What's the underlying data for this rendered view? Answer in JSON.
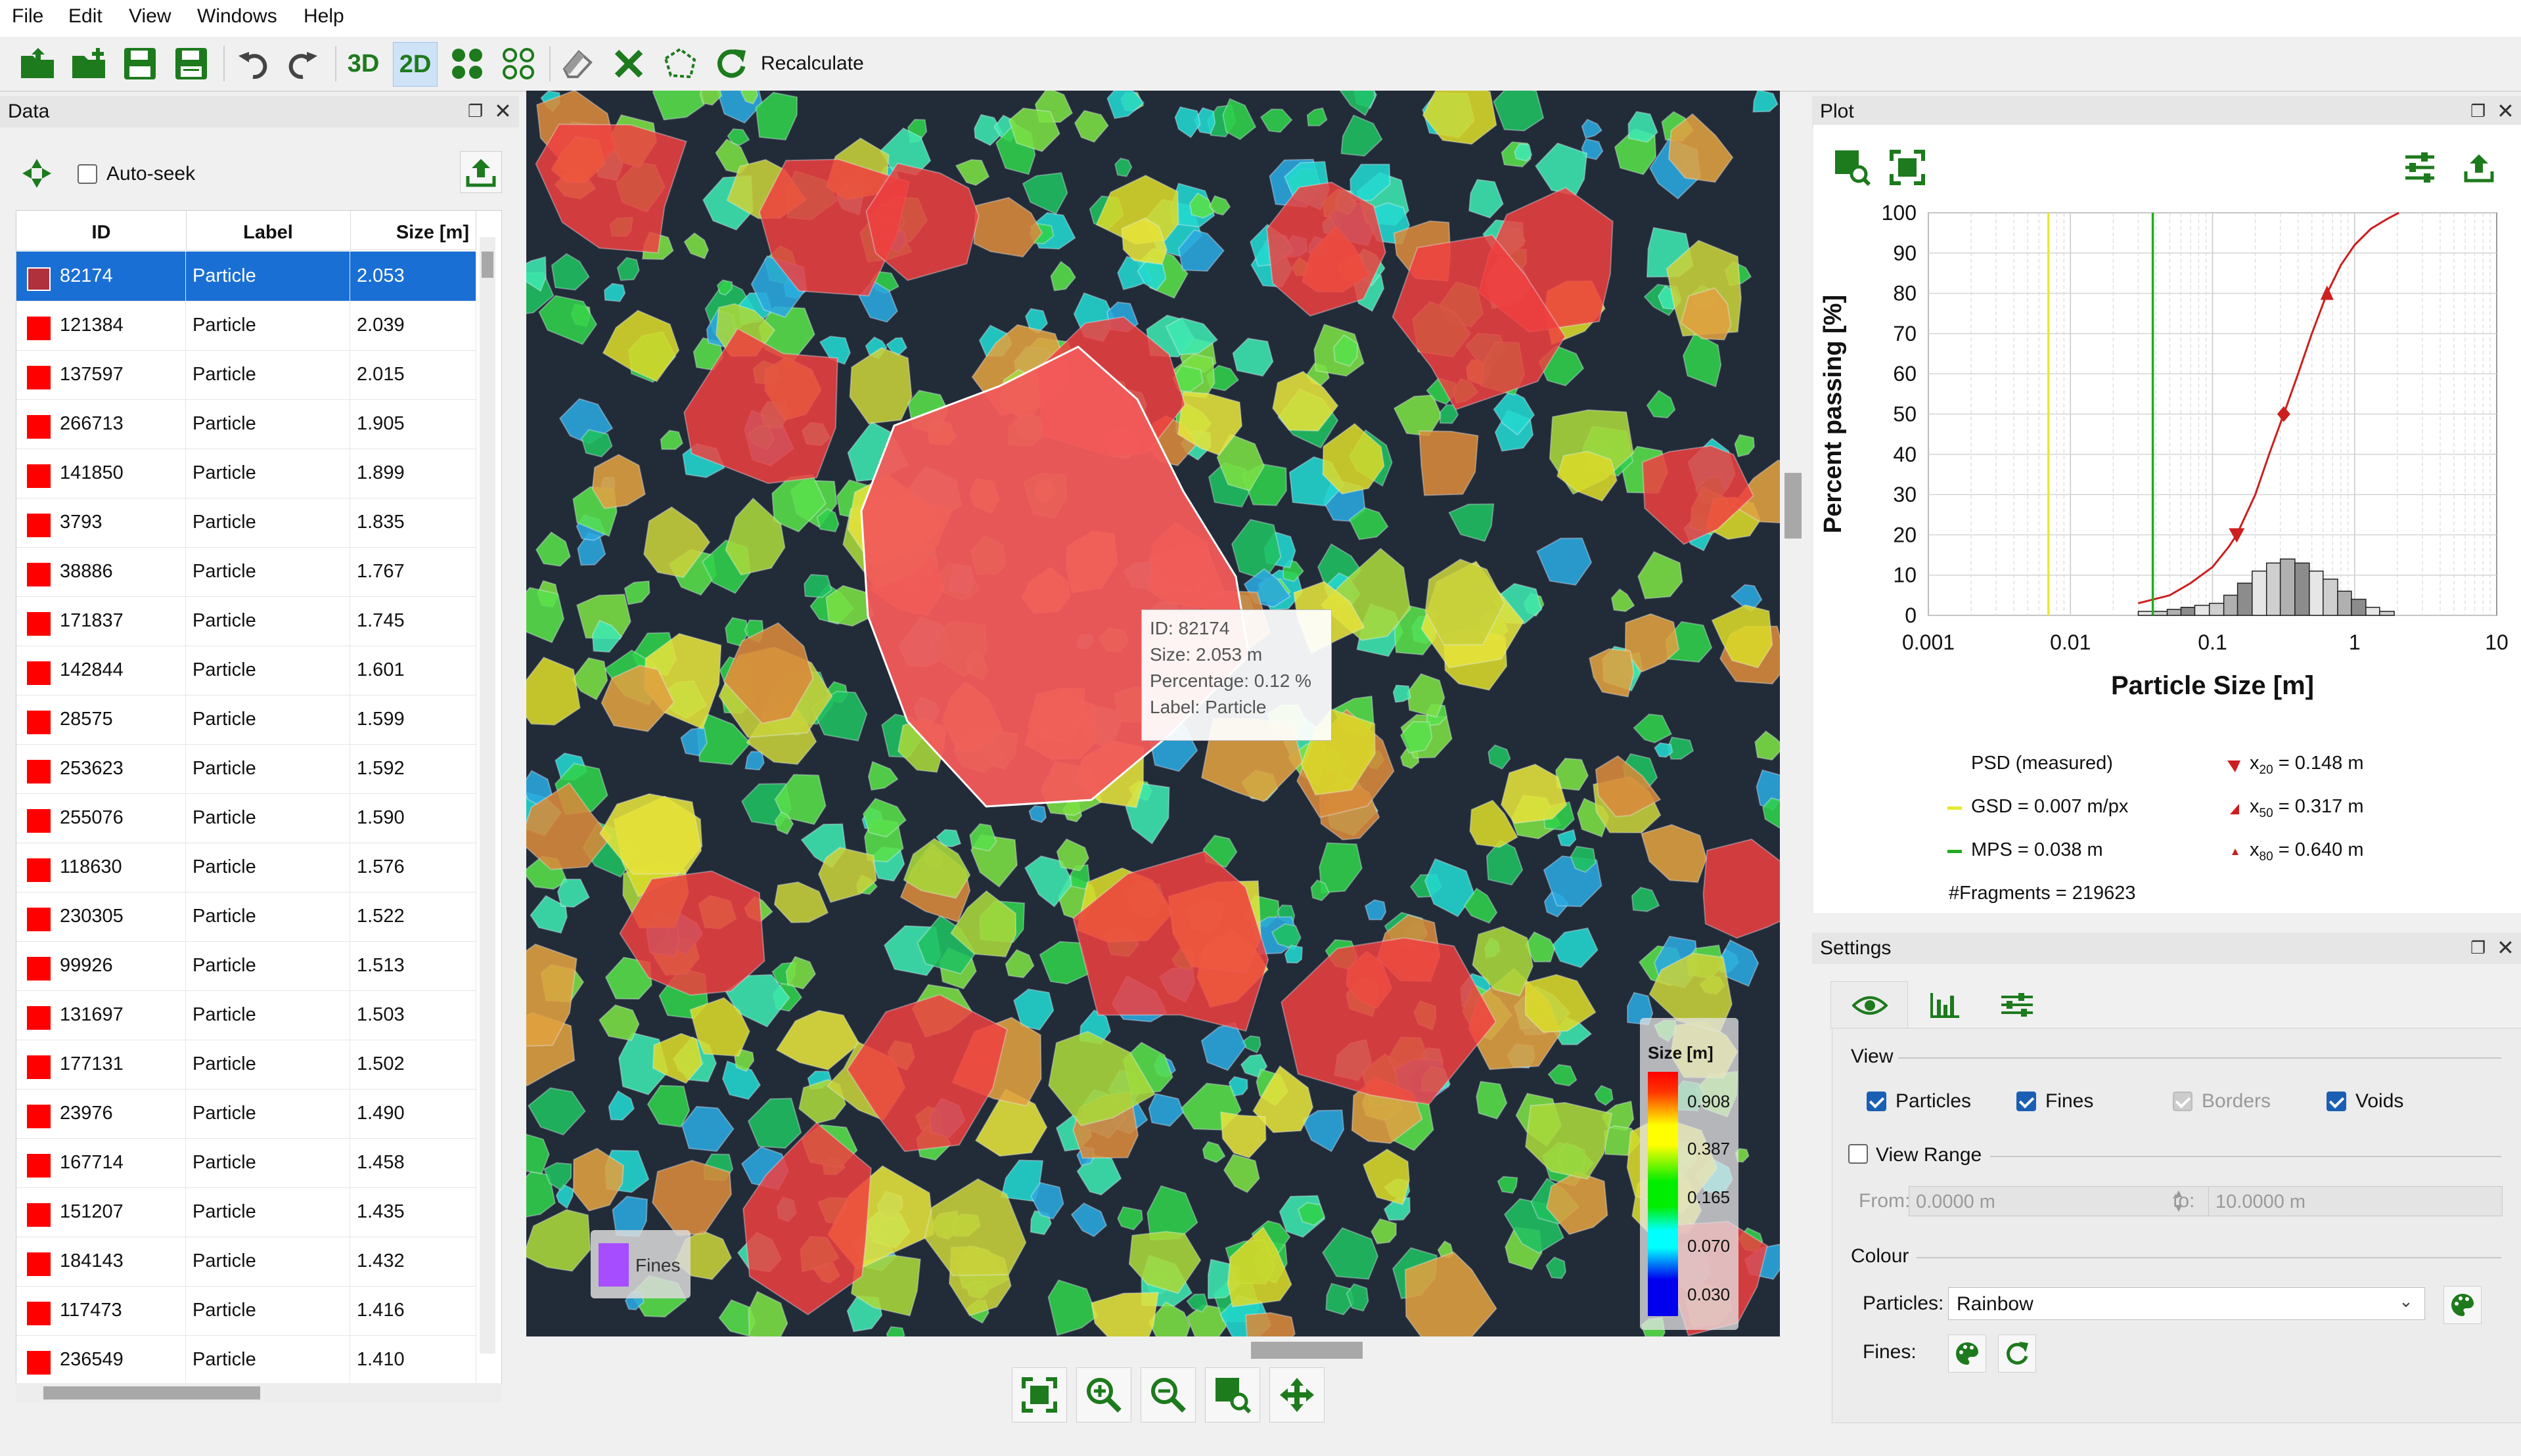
{
  "menu": [
    "File",
    "Edit",
    "View",
    "Windows",
    "Help"
  ],
  "toolbar": {
    "btn_3d": "3D",
    "btn_2d": "2D",
    "recalculate": "Recalculate"
  },
  "data_panel": {
    "title": "Data",
    "auto_seek": "Auto-seek",
    "columns": [
      "ID",
      "Label",
      "Size [m]"
    ],
    "rows": [
      {
        "id": "82174",
        "label": "Particle",
        "size": "2.053"
      },
      {
        "id": "121384",
        "label": "Particle",
        "size": "2.039"
      },
      {
        "id": "137597",
        "label": "Particle",
        "size": "2.015"
      },
      {
        "id": "266713",
        "label": "Particle",
        "size": "1.905"
      },
      {
        "id": "141850",
        "label": "Particle",
        "size": "1.899"
      },
      {
        "id": "3793",
        "label": "Particle",
        "size": "1.835"
      },
      {
        "id": "38886",
        "label": "Particle",
        "size": "1.767"
      },
      {
        "id": "171837",
        "label": "Particle",
        "size": "1.745"
      },
      {
        "id": "142844",
        "label": "Particle",
        "size": "1.601"
      },
      {
        "id": "28575",
        "label": "Particle",
        "size": "1.599"
      },
      {
        "id": "253623",
        "label": "Particle",
        "size": "1.592"
      },
      {
        "id": "255076",
        "label": "Particle",
        "size": "1.590"
      },
      {
        "id": "118630",
        "label": "Particle",
        "size": "1.576"
      },
      {
        "id": "230305",
        "label": "Particle",
        "size": "1.522"
      },
      {
        "id": "99926",
        "label": "Particle",
        "size": "1.513"
      },
      {
        "id": "131697",
        "label": "Particle",
        "size": "1.503"
      },
      {
        "id": "177131",
        "label": "Particle",
        "size": "1.502"
      },
      {
        "id": "23976",
        "label": "Particle",
        "size": "1.490"
      },
      {
        "id": "167714",
        "label": "Particle",
        "size": "1.458"
      },
      {
        "id": "151207",
        "label": "Particle",
        "size": "1.435"
      },
      {
        "id": "184143",
        "label": "Particle",
        "size": "1.432"
      },
      {
        "id": "117473",
        "label": "Particle",
        "size": "1.416"
      },
      {
        "id": "236549",
        "label": "Particle",
        "size": "1.410"
      }
    ]
  },
  "tooltip": {
    "id": "ID: 82174",
    "size": "Size: 2.053 m",
    "percentage": "Percentage: 0.12 %",
    "label": "Label: Particle"
  },
  "size_legend": {
    "title": "Size [m]",
    "entries": [
      {
        "value": "0.908",
        "color": "#ff0000"
      },
      {
        "value": "0.387",
        "color": "#ffff00"
      },
      {
        "value": "0.165",
        "color": "#00ee00"
      },
      {
        "value": "0.070",
        "color": "#00ffff"
      },
      {
        "value": "0.030",
        "color": "#0000ee"
      }
    ]
  },
  "fines_legend": {
    "label": "Fines",
    "color": "#a64dff"
  },
  "plot_panel": {
    "title": "Plot",
    "legend": {
      "psd": "PSD (measured)",
      "gsd": "GSD = 0.007 m/px",
      "mps": "MPS = 0.038 m",
      "fragments": "#Fragments = 219623",
      "x20": "= 0.148 m",
      "x50": "= 0.317 m",
      "x80": "= 0.640 m",
      "x20_sub": "20",
      "x50_sub": "50",
      "x80_sub": "80",
      "x_sym": "x"
    }
  },
  "chart_data": {
    "type": "line",
    "xlabel": "Particle Size [m]",
    "ylabel": "Percent passing [%]",
    "xscale": "log",
    "xlim": [
      0.001,
      10
    ],
    "ylim": [
      0,
      100
    ],
    "xticks": [
      "0.001",
      "0.01",
      "0.1",
      "1",
      "10"
    ],
    "yticks": [
      "0",
      "10",
      "20",
      "30",
      "40",
      "50",
      "60",
      "70",
      "80",
      "90",
      "100"
    ],
    "grid": true,
    "series": [
      {
        "name": "PSD (measured)",
        "color": "#cc1f1f",
        "x": [
          0.03,
          0.05,
          0.07,
          0.1,
          0.13,
          0.148,
          0.2,
          0.25,
          0.317,
          0.4,
          0.5,
          0.64,
          0.8,
          1.0,
          1.3,
          1.7,
          2.05
        ],
        "y": [
          3,
          5,
          8,
          12,
          17,
          20,
          30,
          40,
          50,
          60,
          70,
          80,
          87,
          92,
          96,
          98.5,
          100
        ]
      },
      {
        "name": "GSD",
        "color": "#e8e830",
        "x": [
          0.007,
          0.007
        ],
        "y": [
          0,
          100
        ]
      },
      {
        "name": "MPS",
        "color": "#22aa22",
        "x": [
          0.038,
          0.038
        ],
        "y": [
          0,
          100
        ]
      }
    ],
    "markers": [
      {
        "name": "x20",
        "x": 0.148,
        "y": 20
      },
      {
        "name": "x50",
        "x": 0.317,
        "y": 50
      },
      {
        "name": "x80",
        "x": 0.64,
        "y": 80
      }
    ],
    "histogram": {
      "bins": [
        0.03,
        0.038,
        0.048,
        0.06,
        0.075,
        0.095,
        0.12,
        0.15,
        0.19,
        0.24,
        0.3,
        0.38,
        0.48,
        0.6,
        0.76,
        0.95,
        1.2,
        1.5,
        1.9
      ],
      "values": [
        1,
        1,
        1.5,
        2,
        2.5,
        3,
        5,
        8,
        11,
        13,
        14,
        13,
        11,
        9,
        6,
        4,
        2,
        1
      ]
    }
  },
  "settings_panel": {
    "title": "Settings",
    "view_group": "View",
    "particles": "Particles",
    "fines": "Fines",
    "borders": "Borders",
    "voids": "Voids",
    "view_range": "View Range",
    "from_label": "From:",
    "from_value": "0.0000 m",
    "to_label": "to:",
    "to_value": "10.0000 m",
    "colour_group": "Colour",
    "particles_label": "Particles:",
    "particles_colour": "Rainbow",
    "fines_label": "Fines:"
  },
  "colors": {
    "accent_green": "#1d7a1d",
    "selection_blue": "#1a6fd4"
  }
}
